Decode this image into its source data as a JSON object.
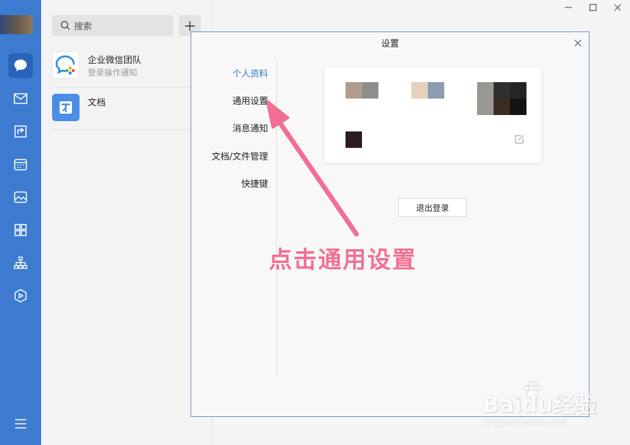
{
  "sidebar": {
    "icons": [
      "message-icon",
      "mail-icon",
      "workbench-icon",
      "calendar-icon",
      "photo-icon",
      "apps-icon",
      "org-chart-icon",
      "cube-icon",
      "menu-icon"
    ]
  },
  "search": {
    "placeholder": "搜索"
  },
  "sessions": [
    {
      "title": "企业微信团队",
      "subtitle": "登录操作通知"
    },
    {
      "title": "文档",
      "subtitle": ""
    }
  ],
  "dialog": {
    "title": "设置",
    "nav": [
      {
        "label": "个人资料",
        "active": true
      },
      {
        "label": "通用设置",
        "active": false
      },
      {
        "label": "消息通知",
        "active": false
      },
      {
        "label": "文档/文件管理",
        "active": false
      },
      {
        "label": "快捷键",
        "active": false
      }
    ],
    "logout_label": "退出登录"
  },
  "annotation": {
    "text": "点击通用设置"
  },
  "watermark": {
    "logo": "Baidu经验",
    "url": "jingyan.baidu.com"
  },
  "colors": {
    "accent": "#3d7bd1",
    "nav_active": "#2f7ad0",
    "annotation": "#f26f92"
  }
}
